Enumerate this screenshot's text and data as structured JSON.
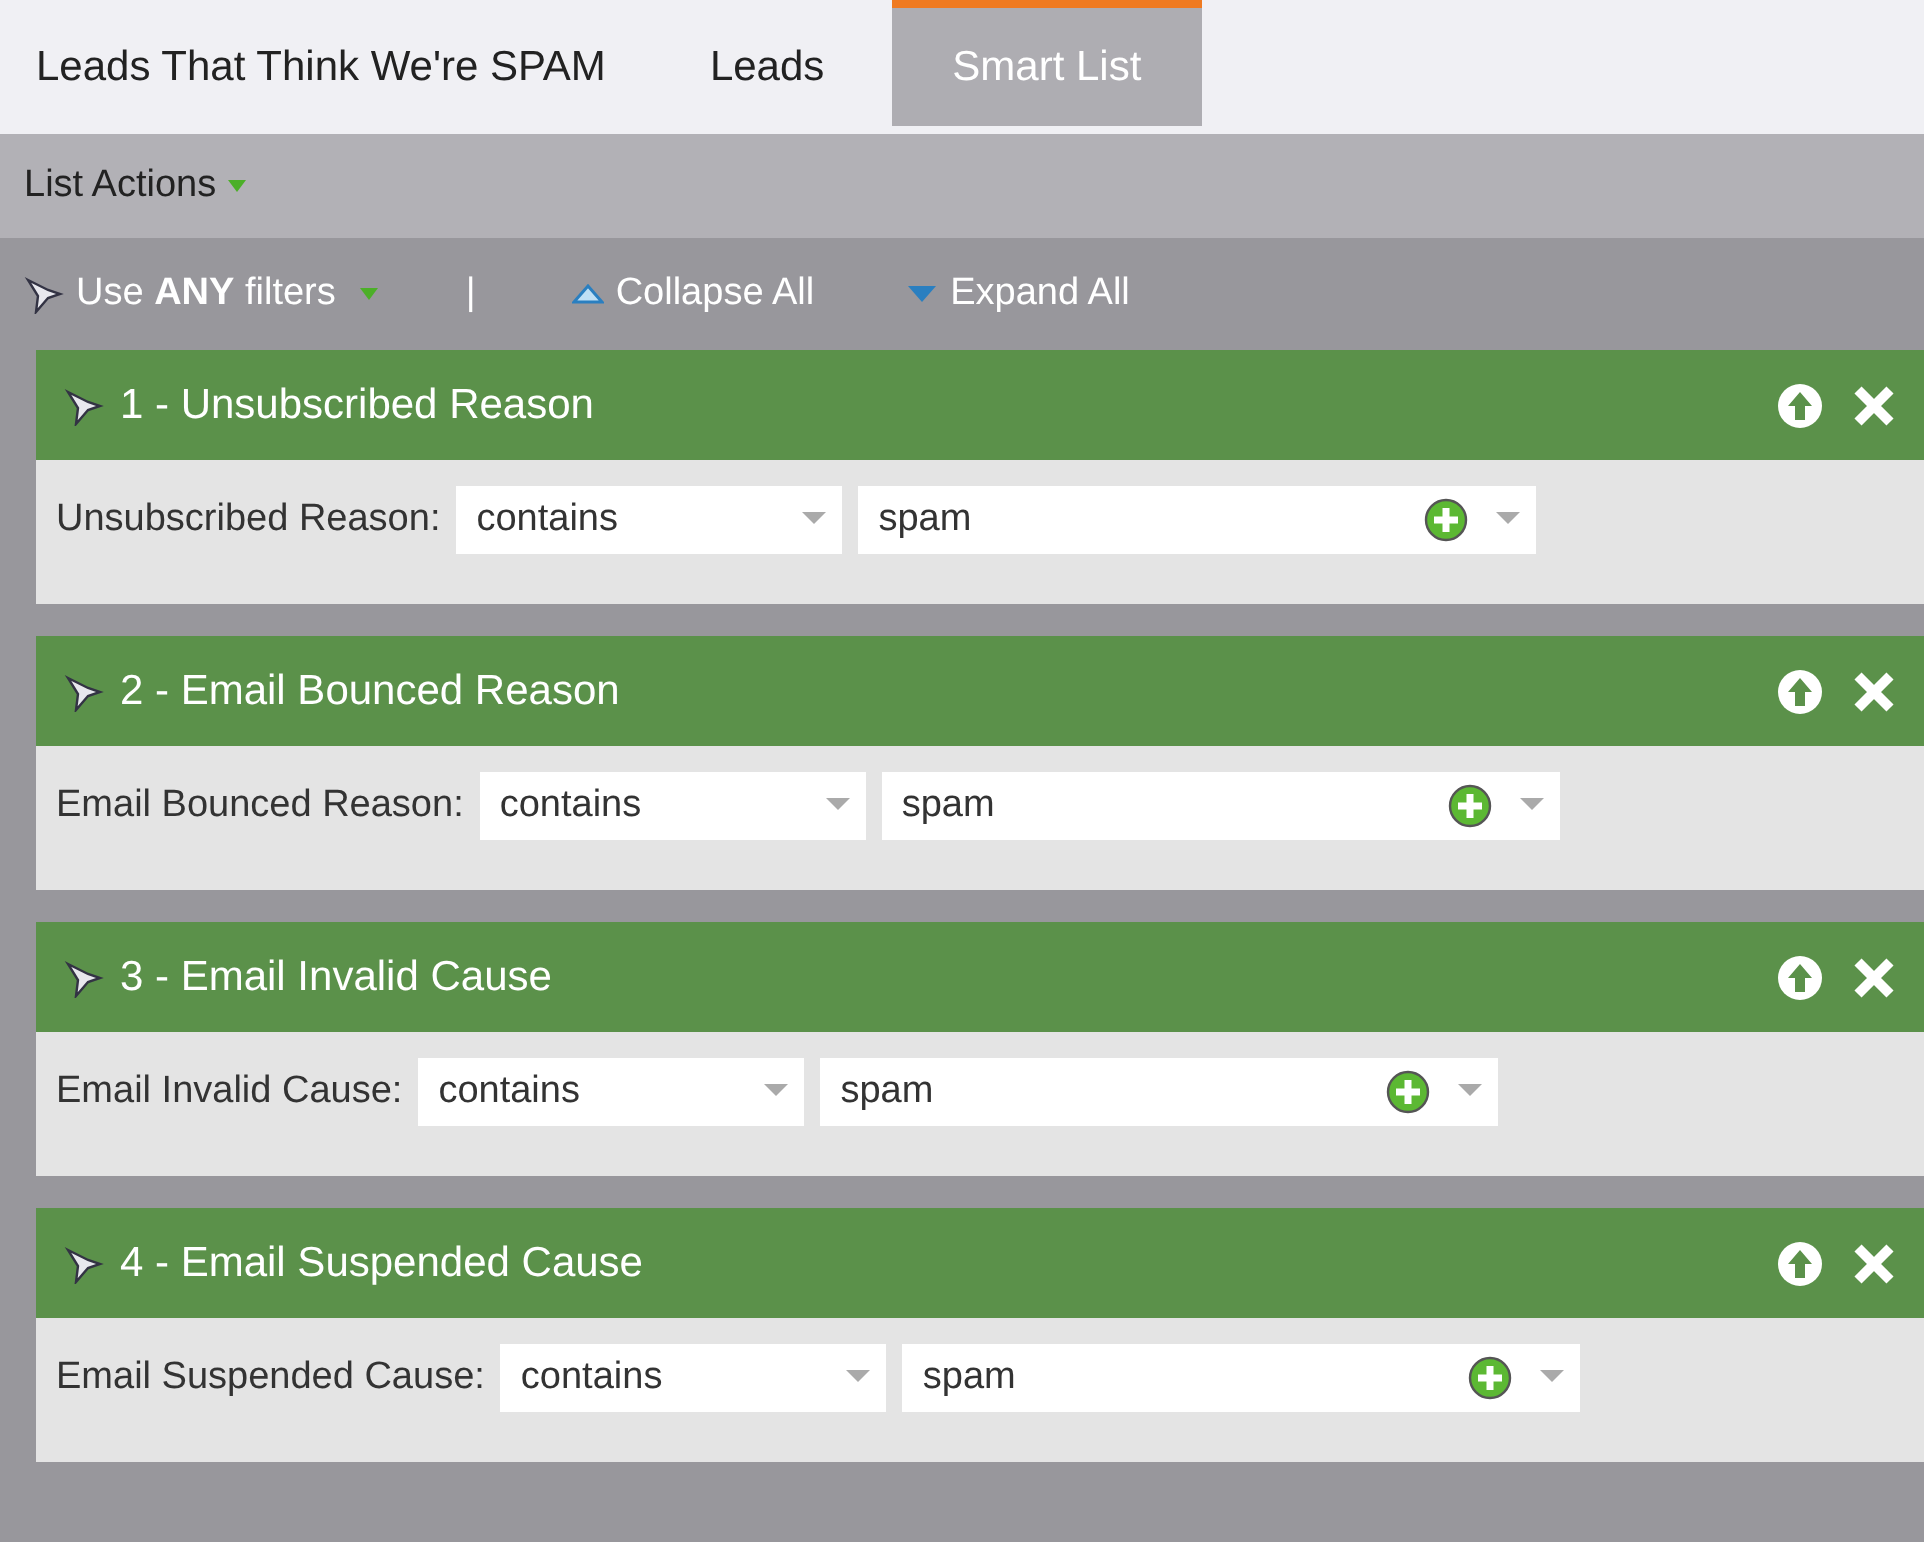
{
  "tabs": [
    {
      "label": "Leads That Think We're SPAM",
      "selected": false
    },
    {
      "label": "Leads",
      "selected": false
    },
    {
      "label": "Smart List",
      "selected": true
    }
  ],
  "list_actions": "List Actions",
  "toolbar": {
    "filter_mode": "Use **ANY** filters",
    "separator": "|",
    "collapse_all": "Collapse All",
    "expand_all": "Expand All"
  },
  "filters": [
    {
      "title": "1 - Unsubscribed Reason",
      "label": "Unsubscribed Reason:",
      "operator": "contains",
      "value": "spam"
    },
    {
      "title": "2 - Email Bounced Reason",
      "label": "Email Bounced Reason:",
      "operator": "contains",
      "value": "spam"
    },
    {
      "title": "3 - Email Invalid Cause",
      "label": "Email Invalid Cause:",
      "operator": "contains",
      "value": "spam"
    },
    {
      "title": "4 - Email Suspended Cause",
      "label": "Email Suspended Cause:",
      "operator": "contains",
      "value": "spam"
    }
  ]
}
